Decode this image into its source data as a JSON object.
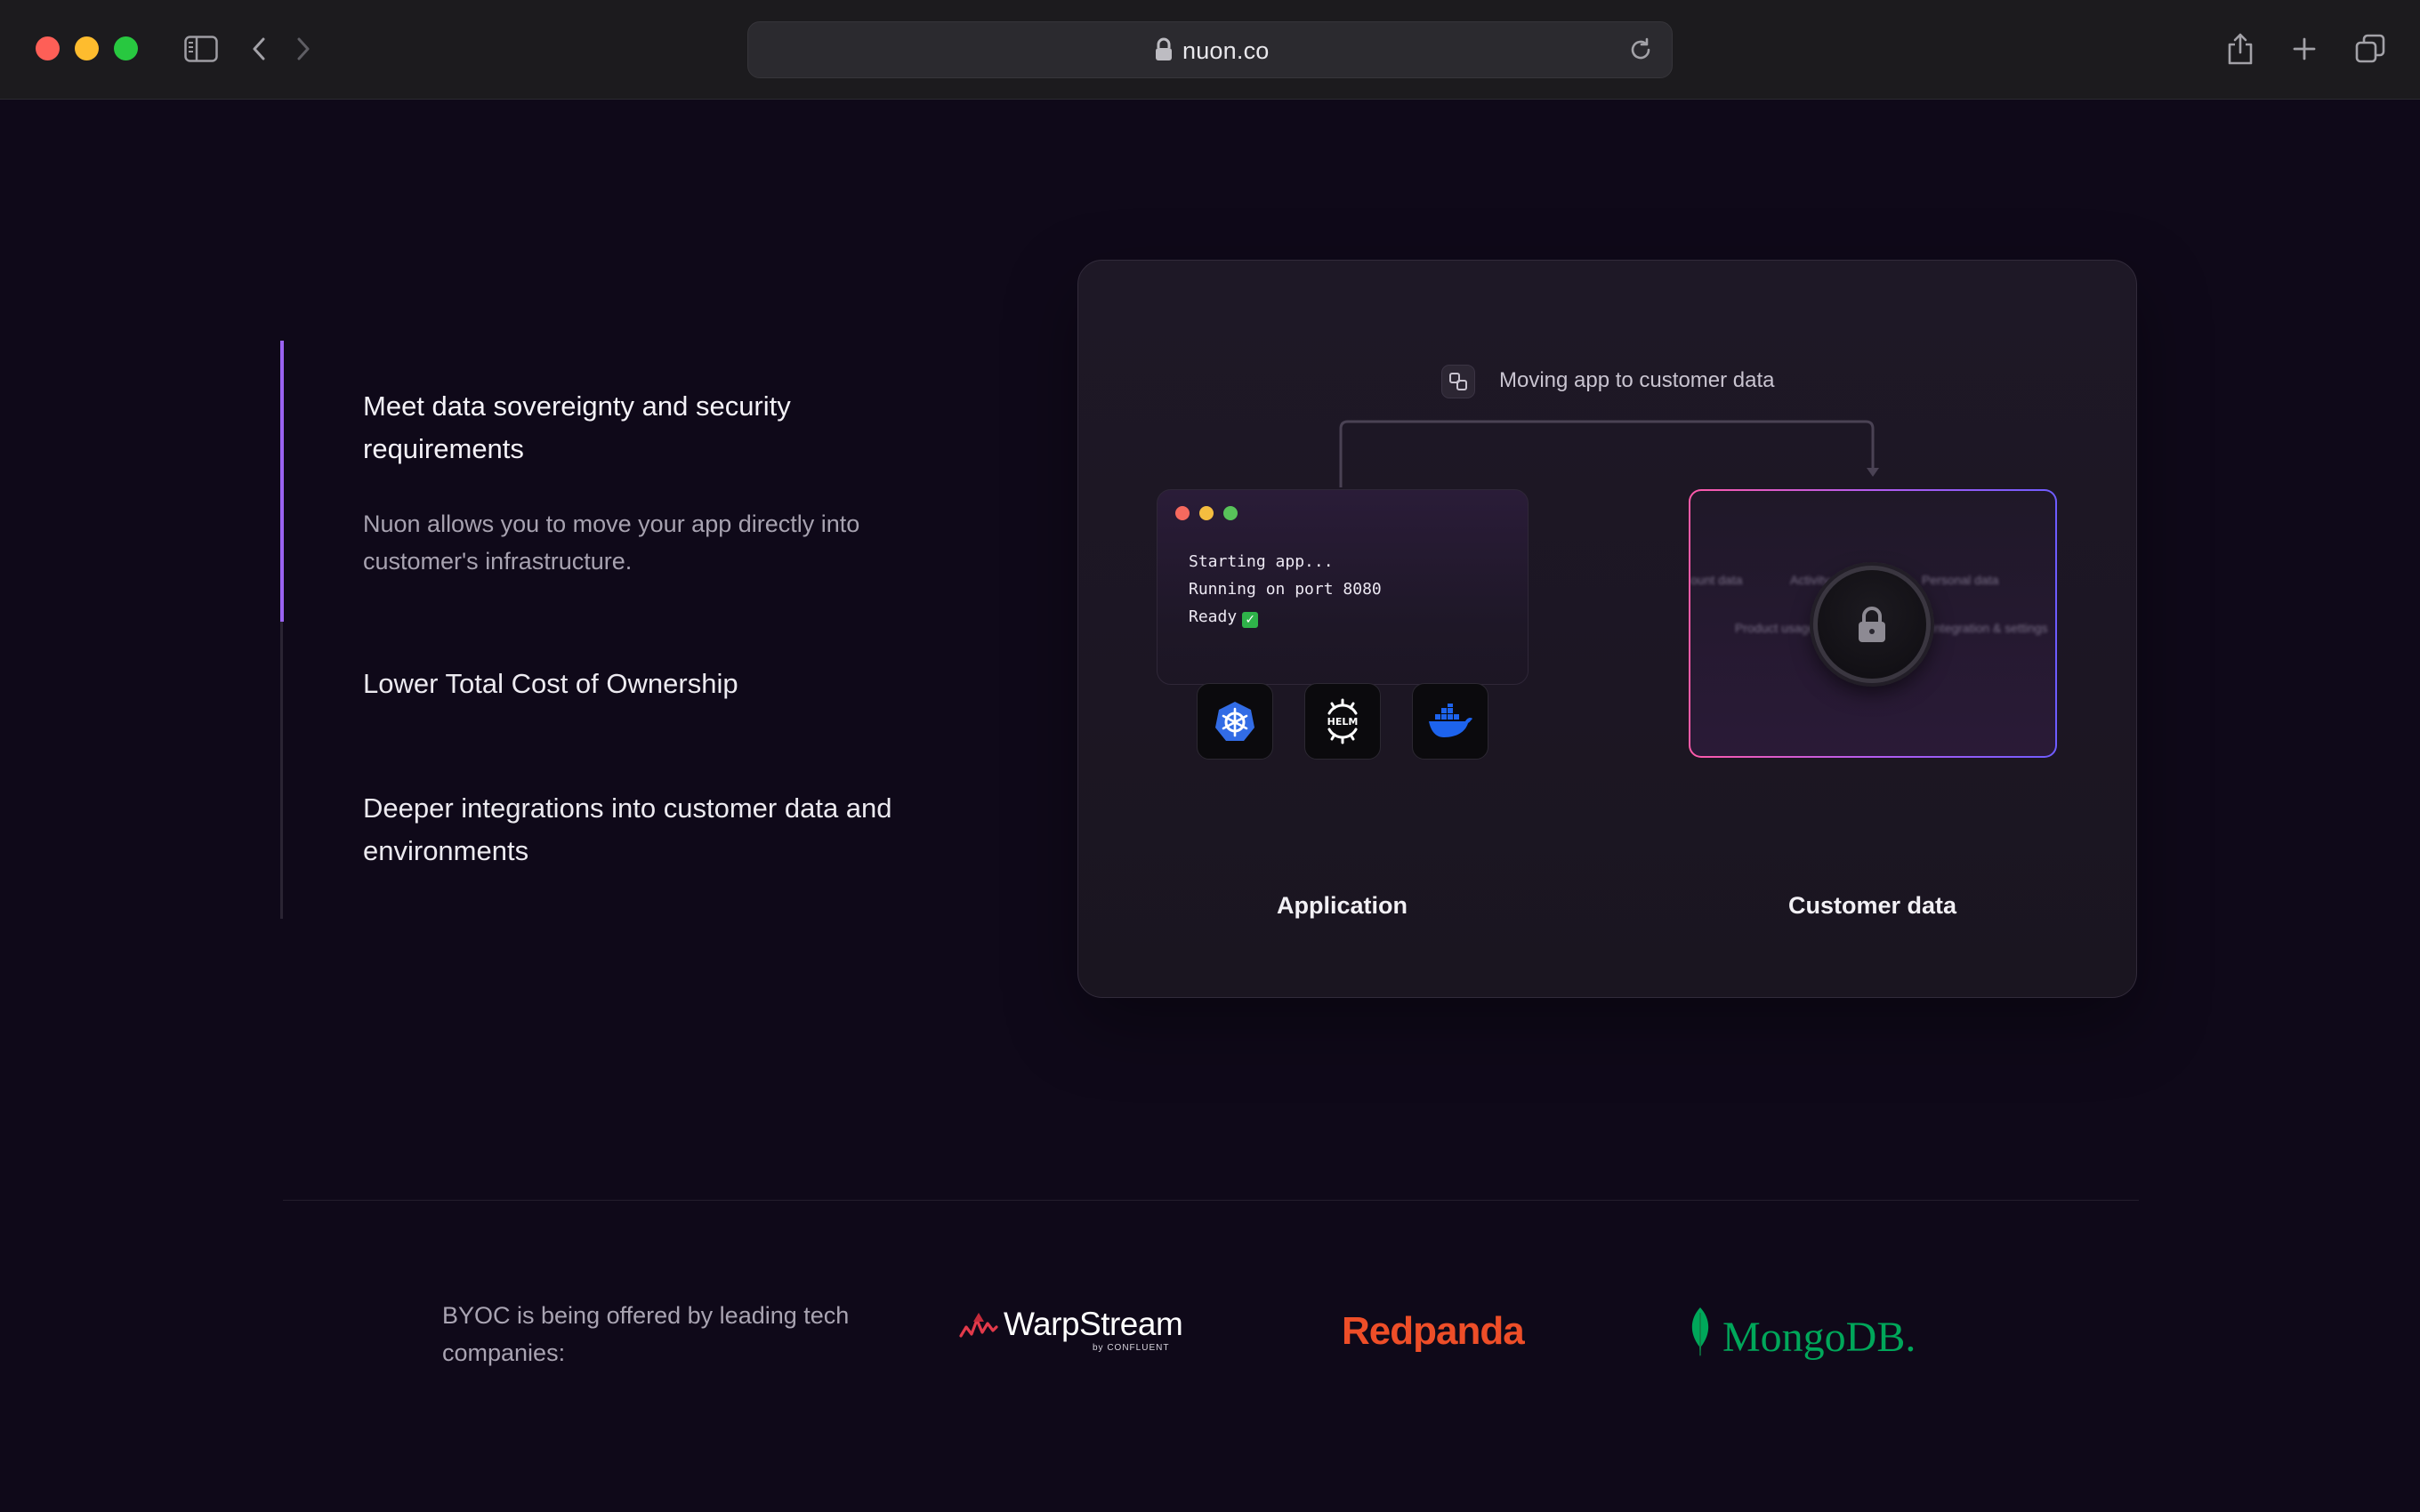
{
  "browser": {
    "url": "nuon.co",
    "icons": [
      "sidebar-icon",
      "chevron-left-icon",
      "chevron-right-icon",
      "lock-icon",
      "reload-icon",
      "share-icon",
      "plus-icon",
      "tabs-overview-icon"
    ]
  },
  "features": [
    {
      "title": "Meet data sovereignty and security requirements",
      "description": "Nuon allows you to move your app directly into customer's infrastructure.",
      "active": true
    },
    {
      "title": "Lower Total Cost of Ownership",
      "active": false
    },
    {
      "title": "Deeper integrations into customer data and environments",
      "active": false
    }
  ],
  "diagram": {
    "flow_label": "Moving app to customer data",
    "terminal_lines": [
      "Starting app...",
      "Running on port 8080",
      "Ready"
    ],
    "tools": [
      "kubernetes-icon",
      "helm-icon",
      "docker-icon"
    ],
    "data_tags": [
      "ount data",
      "Activity",
      "Personal data",
      "Product usage",
      "Integration & settings"
    ],
    "application_label": "Application",
    "customer_label": "Customer data"
  },
  "partners": {
    "intro": "BYOC is being offered by leading tech companies:",
    "logos": [
      {
        "name": "WarpStream",
        "byline": "by CONFLUENT"
      },
      {
        "name": "Redpanda"
      },
      {
        "name": "MongoDB."
      }
    ]
  },
  "colors": {
    "background": "#0f0919",
    "accent_purple": "#9a62f2",
    "redpanda": "#ee4e28",
    "mongodb": "#00a75a",
    "warpstream_icon": "#e33a4b"
  }
}
